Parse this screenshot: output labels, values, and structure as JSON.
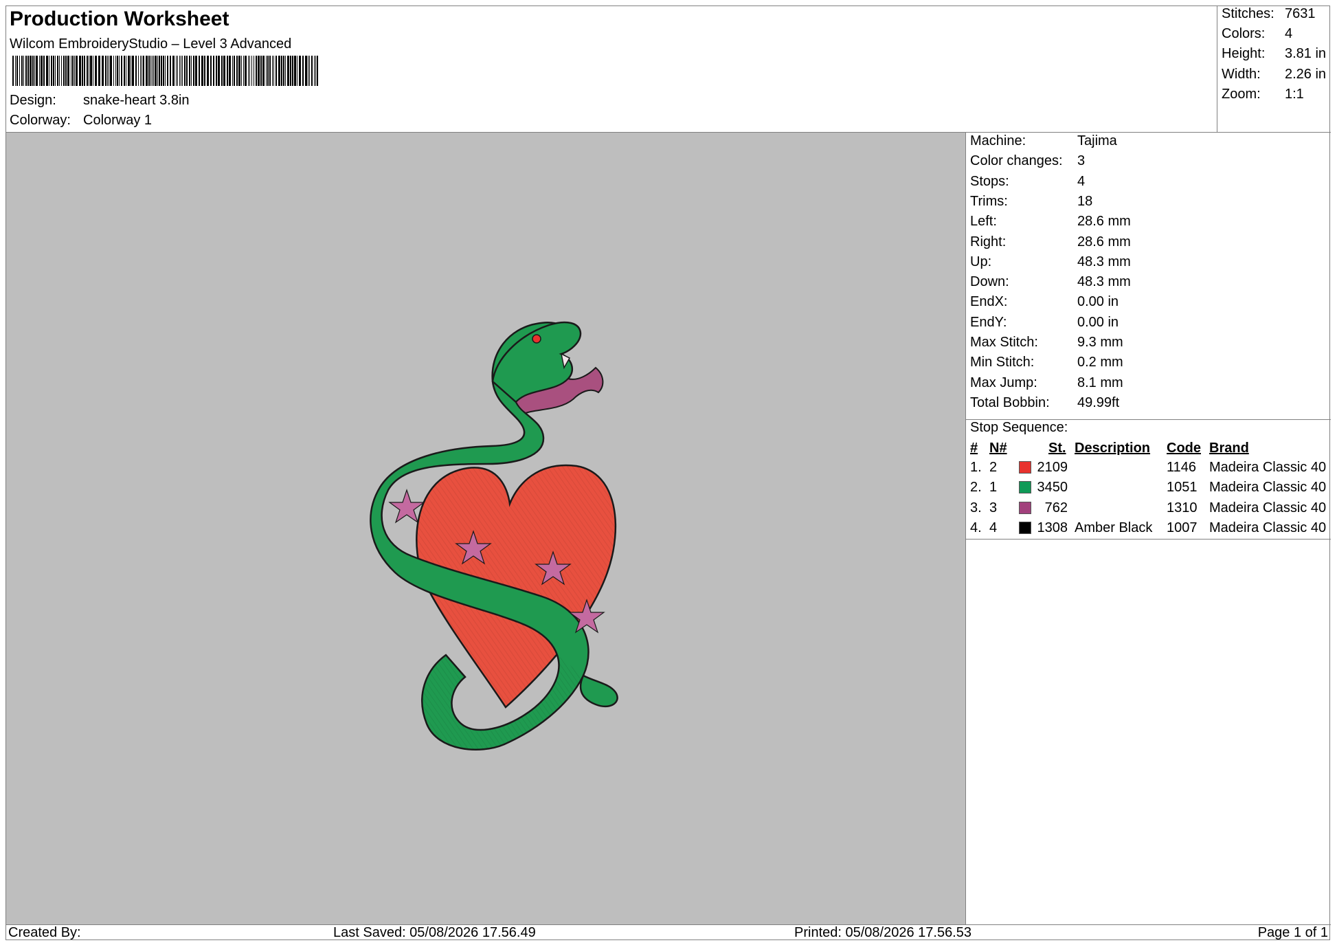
{
  "header": {
    "title": "Production Worksheet",
    "subtitle": "Wilcom EmbroideryStudio – Level 3 Advanced",
    "design_label": "Design:",
    "design_value": "snake-heart 3.8in",
    "colorway_label": "Colorway:",
    "colorway_value": "Colorway 1"
  },
  "stats": [
    {
      "label": "Stitches:",
      "value": "7631"
    },
    {
      "label": "Colors:",
      "value": "4"
    },
    {
      "label": "Height:",
      "value": "3.81 in"
    },
    {
      "label": "Width:",
      "value": "2.26 in"
    },
    {
      "label": "Zoom:",
      "value": "1:1"
    }
  ],
  "machine_info": [
    {
      "label": "Machine:",
      "value": "Tajima"
    },
    {
      "label": "Color changes:",
      "value": "3"
    },
    {
      "label": "Stops:",
      "value": "4"
    },
    {
      "label": "Trims:",
      "value": "18"
    },
    {
      "label": "Left:",
      "value": "28.6 mm"
    },
    {
      "label": "Right:",
      "value": "28.6 mm"
    },
    {
      "label": "Up:",
      "value": "48.3 mm"
    },
    {
      "label": "Down:",
      "value": "48.3 mm"
    },
    {
      "label": "EndX:",
      "value": "0.00 in"
    },
    {
      "label": "EndY:",
      "value": "0.00 in"
    },
    {
      "label": "Max Stitch:",
      "value": "9.3 mm"
    },
    {
      "label": "Min Stitch:",
      "value": "0.2 mm"
    },
    {
      "label": "Max Jump:",
      "value": "8.1 mm"
    },
    {
      "label": "Total Bobbin:",
      "value": "49.99ft"
    }
  ],
  "stop_sequence": {
    "title": "Stop Sequence:",
    "headers": {
      "num": "#",
      "n": "N#",
      "st": "St.",
      "description": "Description",
      "code": "Code",
      "brand": "Brand"
    },
    "rows": [
      {
        "num": "1.",
        "n": "2",
        "color": "#e8322e",
        "st": "2109",
        "description": "",
        "code": "1146",
        "brand": "Madeira Classic 40"
      },
      {
        "num": "2.",
        "n": "1",
        "color": "#0f9a57",
        "st": "3450",
        "description": "",
        "code": "1051",
        "brand": "Madeira Classic 40"
      },
      {
        "num": "3.",
        "n": "3",
        "color": "#a2407c",
        "st": "762",
        "description": "",
        "code": "1310",
        "brand": "Madeira Classic 40"
      },
      {
        "num": "4.",
        "n": "4",
        "color": "#000000",
        "st": "1308",
        "description": "Amber Black",
        "code": "1007",
        "brand": "Madeira Classic 40"
      }
    ]
  },
  "footer": {
    "created_by": "Created By:",
    "last_saved": "Last Saved: 05/08/2026 17.56.49",
    "printed": "Printed: 05/08/2026 17.56.53",
    "page": "Page 1 of 1"
  },
  "design_colors": {
    "snake": "#1f9a50",
    "heart": "#e8503f",
    "stars": "#c46aa0",
    "outline": "#1a1a1a",
    "background": "#bebebe"
  }
}
